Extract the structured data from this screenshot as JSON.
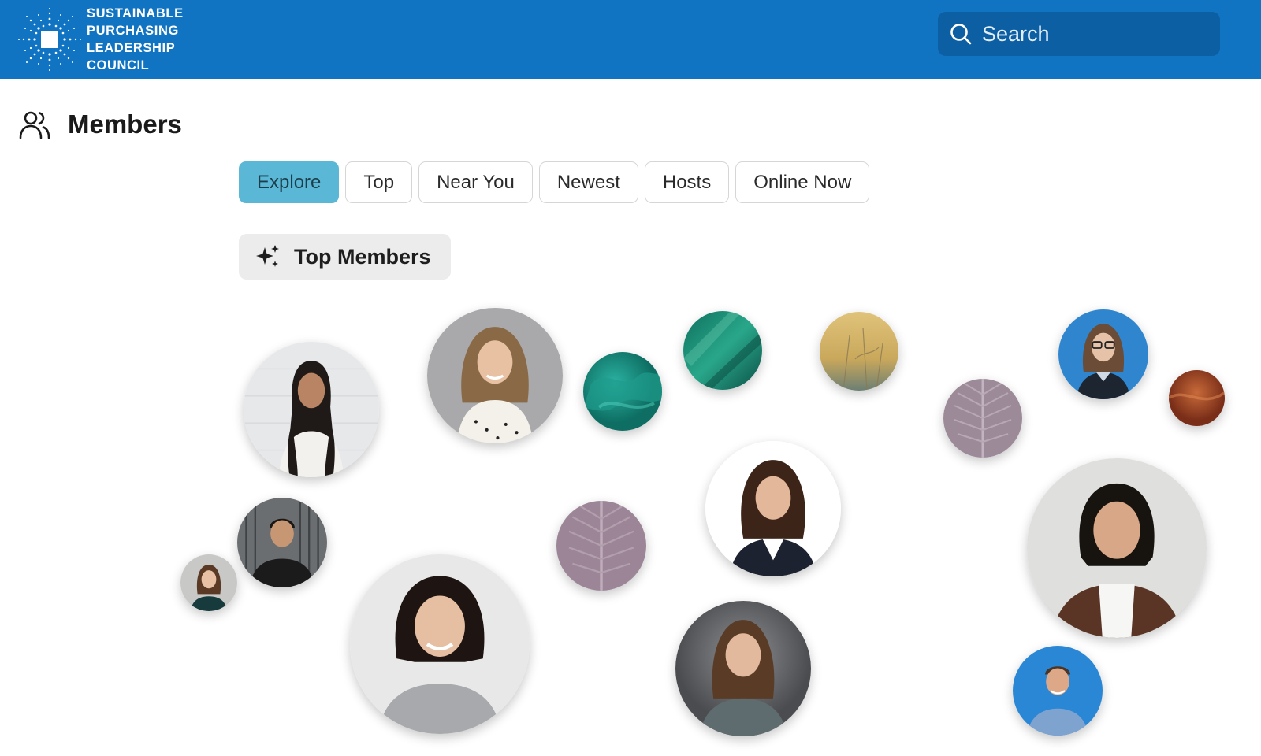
{
  "header": {
    "logo_lines": [
      "SUSTAINABLE",
      "PURCHASING",
      "LEADERSHIP",
      "COUNCIL"
    ],
    "search_placeholder": "Search",
    "brand_color": "#1174c2"
  },
  "page": {
    "title": "Members",
    "title_icon": "users-icon"
  },
  "tabs": [
    {
      "label": "Explore",
      "active": true
    },
    {
      "label": "Top",
      "active": false
    },
    {
      "label": "Near You",
      "active": false
    },
    {
      "label": "Newest",
      "active": false
    },
    {
      "label": "Hosts",
      "active": false
    },
    {
      "label": "Online Now",
      "active": false
    }
  ],
  "section": {
    "label": "Top Members",
    "icon": "sparkles-icon"
  },
  "accent_color": "#5ab8d6"
}
